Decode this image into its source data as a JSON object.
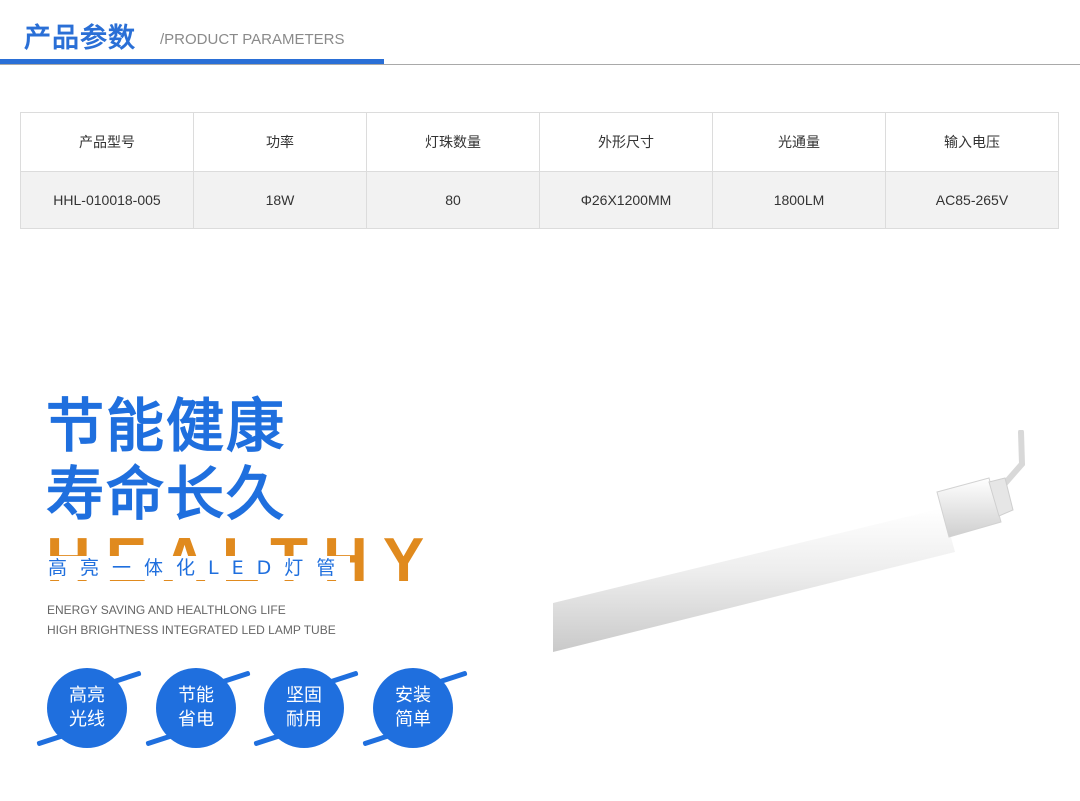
{
  "header": {
    "title_cn": "产品参数",
    "title_en": "/PRODUCT PARAMETERS"
  },
  "table": {
    "headers": [
      "产品型号",
      "功率",
      "灯珠数量",
      "外形尺寸",
      "光通量",
      "输入电压"
    ],
    "values": [
      "HHL-010018-005",
      "18W",
      "80",
      "Φ26X1200MM",
      "1800LM",
      "AC85-265V"
    ]
  },
  "promo": {
    "line1": "节能健康",
    "line2": "寿命长久",
    "big_word": "HEALTHY",
    "subtitle_cn": "高亮一体化LED灯管",
    "en_line1": "ENERGY SAVING AND HEALTHLONG LIFE",
    "en_line2": "HIGH BRIGHTNESS INTEGRATED LED LAMP TUBE"
  },
  "features": [
    {
      "line1": "高亮",
      "line2": "光线"
    },
    {
      "line1": "节能",
      "line2": "省电"
    },
    {
      "line1": "坚固",
      "line2": "耐用"
    },
    {
      "line1": "安装",
      "line2": "简单"
    }
  ],
  "colors": {
    "brand_blue": "#1f6fde",
    "accent_orange": "#e08a1e",
    "table_value_bg": "#f2f2f2"
  }
}
